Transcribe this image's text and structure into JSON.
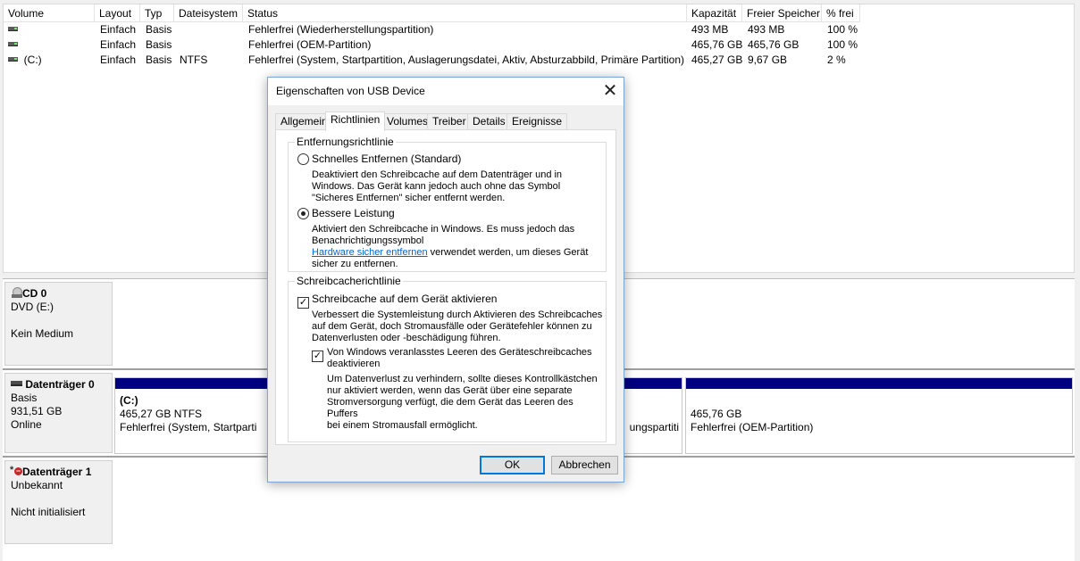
{
  "volume_list": {
    "columns": [
      "Volume",
      "Layout",
      "Typ",
      "Dateisystem",
      "Status",
      "Kapazität",
      "Freier Speicher",
      "% frei"
    ],
    "rows": [
      {
        "volume": "",
        "layout": "Einfach",
        "type": "Basis",
        "fs": "",
        "status": "Fehlerfrei (Wiederherstellungspartition)",
        "capacity": "493 MB",
        "free": "493 MB",
        "pct": "100 %"
      },
      {
        "volume": "",
        "layout": "Einfach",
        "type": "Basis",
        "fs": "",
        "status": "Fehlerfrei (OEM-Partition)",
        "capacity": "465,76 GB",
        "free": "465,76 GB",
        "pct": "100 %"
      },
      {
        "volume": "(C:)",
        "layout": "Einfach",
        "type": "Basis",
        "fs": "NTFS",
        "status": "Fehlerfrei (System, Startpartition, Auslagerungsdatei, Aktiv, Absturzabbild, Primäre Partition)",
        "capacity": "465,27 GB",
        "free": "9,67 GB",
        "pct": "2 %"
      }
    ]
  },
  "disks": {
    "cd0": {
      "title": "CD 0",
      "line1": "DVD (E:)",
      "line2": "Kein Medium"
    },
    "disk0": {
      "title": "Datenträger 0",
      "line1": "Basis",
      "line2": "931,51 GB",
      "line3": "Online",
      "partitions": [
        {
          "name": "(C:)",
          "size": "465,27 GB NTFS",
          "status": "Fehlerfrei (System, Startparti"
        },
        {
          "status": "ungspartiti"
        },
        {
          "size": "465,76 GB",
          "status": "Fehlerfrei (OEM-Partition)"
        }
      ]
    },
    "disk1": {
      "title": "Datenträger 1",
      "line1": "Unbekannt",
      "line2": "Nicht initialisiert"
    }
  },
  "dialog": {
    "title": "Eigenschaften von USB Device",
    "tabs": [
      "Allgemein",
      "Richtlinien",
      "Volumes",
      "Treiber",
      "Details",
      "Ereignisse"
    ],
    "active_tab": "Richtlinien",
    "removal_group": {
      "label": "Entfernungsrichtlinie",
      "quick": {
        "label": "Schnelles Entfernen (Standard)",
        "selected": false,
        "desc": [
          "Deaktiviert den Schreibcache auf dem Datenträger und in",
          "Windows. Das Gerät kann jedoch auch ohne das Symbol",
          "\"Sicheres Entfernen\" sicher entfernt werden."
        ]
      },
      "better": {
        "label": "Bessere Leistung",
        "selected": true,
        "desc": [
          "Aktiviert den Schreibcache in Windows. Es muss jedoch das",
          "Benachrichtigungssymbol"
        ],
        "link": "Hardware sicher entfernen",
        "desc_after_link": " verwendet werden, um dieses Gerät",
        "desc_last": "sicher zu entfernen."
      }
    },
    "cache_group": {
      "label": "Schreibcacherichtlinie",
      "enable": {
        "label": "Schreibcache auf dem Gerät aktivieren",
        "checked": true,
        "desc": [
          "Verbessert die Systemleistung durch Aktivieren des Schreibcaches",
          "auf dem Gerät, doch Stromausfälle oder Gerätefehler können zu",
          "Datenverlusten oder -beschädigung führen."
        ]
      },
      "flush": {
        "label_lines": [
          "Von Windows veranlasstes Leeren des Geräteschreibcaches",
          "deaktivieren"
        ],
        "checked": true,
        "desc": [
          "Um Datenverlust zu verhindern, sollte dieses Kontrollkästchen",
          "nur aktiviert werden, wenn das Gerät über eine separate",
          "Stromversorgung verfügt, die dem Gerät das Leeren des Puffers",
          "bei einem Stromausfall ermöglicht."
        ]
      }
    },
    "buttons": {
      "ok": "OK",
      "cancel": "Abbrechen"
    }
  }
}
